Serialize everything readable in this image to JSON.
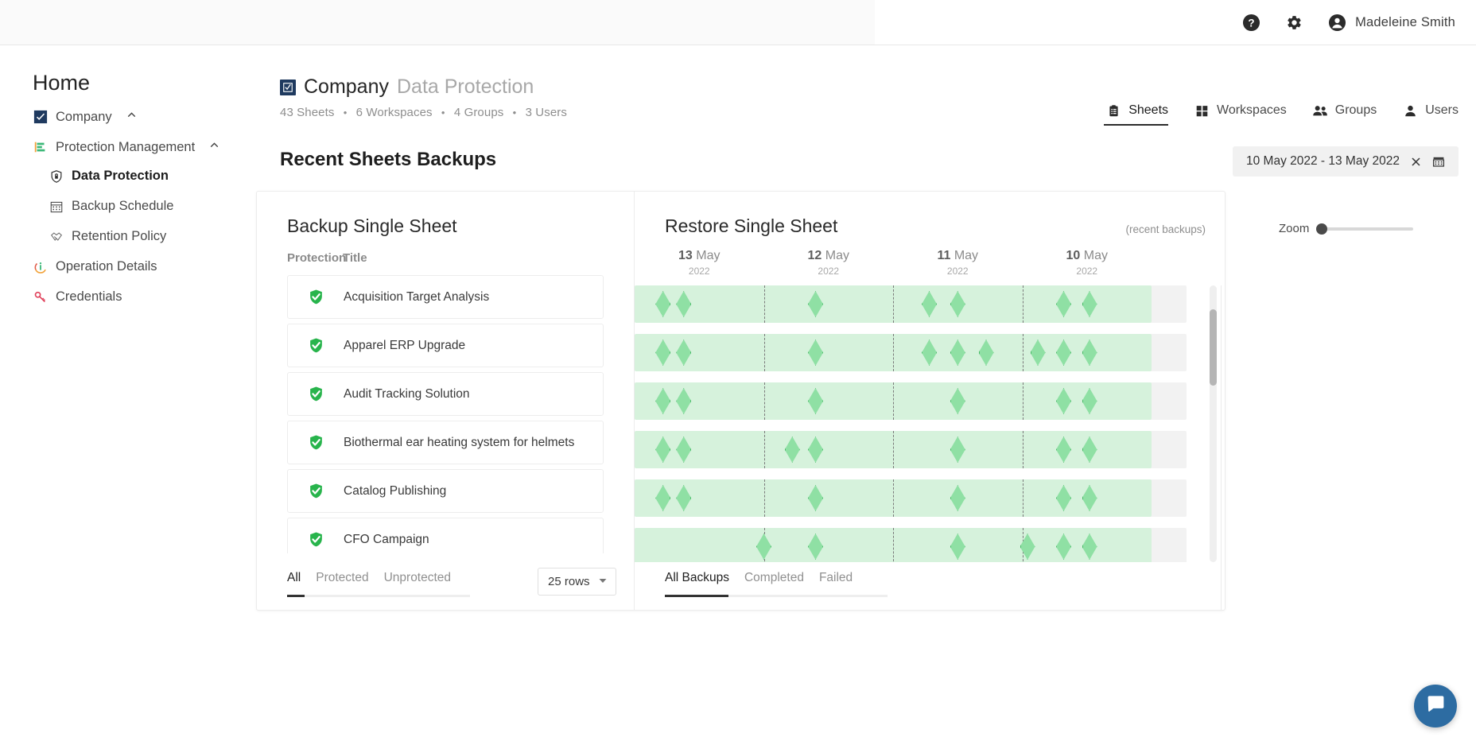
{
  "topbar": {
    "help_icon": "help-circle-icon",
    "settings_icon": "gear-icon",
    "avatar_icon": "account-circle-icon",
    "user_name": "Madeleine Smith"
  },
  "sidebar": {
    "home_label": "Home",
    "items": [
      {
        "label": "Company",
        "icon": "checkbox-square-icon",
        "expanded": true,
        "level": 0
      },
      {
        "label": "Protection Management",
        "icon": "protection-chart-icon",
        "expanded": true,
        "level": 0
      },
      {
        "label": "Data Protection",
        "icon": "shield-lock-icon",
        "level": 1,
        "active": true
      },
      {
        "label": "Backup Schedule",
        "icon": "calendar-icon",
        "level": 1
      },
      {
        "label": "Retention Policy",
        "icon": "handshake-icon",
        "level": 1
      },
      {
        "label": "Operation Details",
        "icon": "info-icon",
        "level": 0
      },
      {
        "label": "Credentials",
        "icon": "key-icon",
        "level": 0
      }
    ]
  },
  "header": {
    "company": "Company",
    "section": "Data Protection",
    "stats": [
      "43 Sheets",
      "6 Workspaces",
      "4 Groups",
      "3 Users"
    ],
    "nav": [
      {
        "label": "Sheets",
        "icon": "clipboard-icon",
        "selected": true
      },
      {
        "label": "Workspaces",
        "icon": "grid-squares-icon",
        "selected": false
      },
      {
        "label": "Groups",
        "icon": "people-icon",
        "selected": false
      },
      {
        "label": "Users",
        "icon": "person-icon",
        "selected": false
      }
    ]
  },
  "page": {
    "title": "Recent Sheets Backups",
    "date_range": "10 May 2022 - 13 May 2022",
    "date_clear_icon": "close-x-icon",
    "date_calendar_icon": "calendar-icon"
  },
  "backup_panel": {
    "title": "Backup Single Sheet",
    "columns": [
      "Protection",
      "Title"
    ],
    "rows": [
      {
        "protection": "protected",
        "title": "Acquisition Target Analysis"
      },
      {
        "protection": "protected",
        "title": "Apparel ERP Upgrade"
      },
      {
        "protection": "protected",
        "title": "Audit Tracking Solution"
      },
      {
        "protection": "protected",
        "title": "Biothermal ear heating system for helmets"
      },
      {
        "protection": "protected",
        "title": "Catalog Publishing"
      },
      {
        "protection": "protected",
        "title": "CFO Campaign"
      }
    ],
    "tabs": [
      {
        "label": "All",
        "selected": true
      },
      {
        "label": "Protected",
        "selected": false
      },
      {
        "label": "Unprotected",
        "selected": false
      }
    ],
    "rows_select": {
      "value": "25 rows",
      "caret_icon": "caret-down-icon"
    }
  },
  "restore_panel": {
    "title": "Restore Single Sheet",
    "zoom_label": "Zoom",
    "zoom_value": 0,
    "recent_note": "(recent backups)",
    "tabs": [
      {
        "label": "All Backups",
        "selected": true
      },
      {
        "label": "Completed",
        "selected": false
      },
      {
        "label": "Failed",
        "selected": false
      }
    ],
    "accent_green": "#8fe0a4",
    "accent_green_border": "#46b864",
    "bar_background": "#d6f2dc",
    "timeline_days": [
      {
        "day": "13",
        "month": "May",
        "year": "2022"
      },
      {
        "day": "12",
        "month": "May",
        "year": "2022"
      },
      {
        "day": "11",
        "month": "May",
        "year": "2022"
      },
      {
        "day": "10",
        "month": "May",
        "year": "2022"
      }
    ],
    "timeline_rows": [
      {
        "backups_pct": [
          5.5,
          9.5,
          35,
          57,
          62.5,
          83,
          88
        ]
      },
      {
        "backups_pct": [
          5.5,
          9.5,
          35,
          57,
          62.5,
          68,
          78,
          83,
          88
        ]
      },
      {
        "backups_pct": [
          5.5,
          9.5,
          35,
          62.5,
          83,
          88
        ]
      },
      {
        "backups_pct": [
          5.5,
          9.5,
          30.5,
          35,
          62.5,
          83,
          88
        ]
      },
      {
        "backups_pct": [
          5.5,
          9.5,
          35,
          62.5,
          83,
          88
        ]
      },
      {
        "backups_pct": [
          25,
          35,
          62.5,
          76,
          83,
          88
        ]
      }
    ]
  },
  "support": {
    "icon": "chat-bubble-icon",
    "color": "#2d6ca2"
  }
}
